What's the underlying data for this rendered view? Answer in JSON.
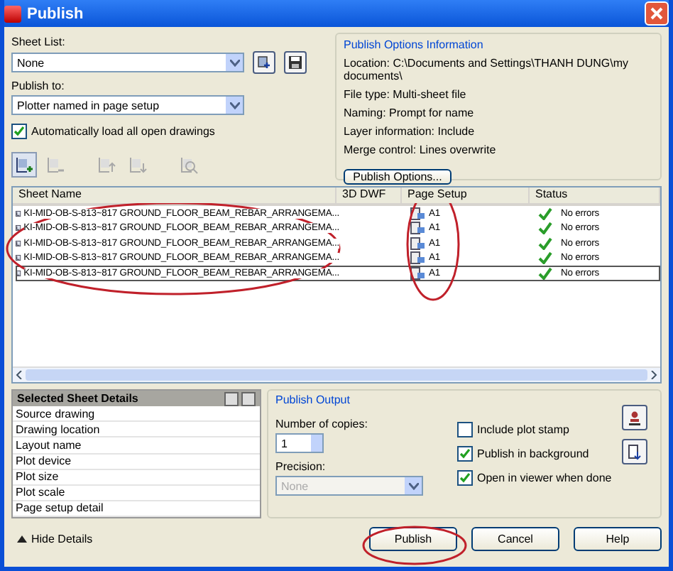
{
  "window": {
    "title": "Publish"
  },
  "sheet_list": {
    "label": "Sheet List:",
    "value": "None"
  },
  "publish_to": {
    "label": "Publish to:",
    "value": "Plotter named in page setup"
  },
  "auto_load": {
    "label": "Automatically load all open drawings",
    "checked": true
  },
  "toolbar": [
    {
      "kind": "add",
      "disabled": false
    },
    {
      "kind": "remove",
      "disabled": true
    },
    {
      "kind": "up",
      "disabled": true
    },
    {
      "kind": "down",
      "disabled": true
    },
    {
      "kind": "preview",
      "disabled": true
    }
  ],
  "options_info": {
    "title": "Publish Options Information",
    "lines": [
      "Location: C:\\Documents and Settings\\THANH DUNG\\my documents\\",
      "File type: Multi-sheet file",
      "Naming: Prompt for name",
      "Layer information: Include",
      "Merge control: Lines overwrite"
    ],
    "button": "Publish Options..."
  },
  "table": {
    "columns": [
      "Sheet Name",
      "3D DWF",
      "Page Setup",
      "Status"
    ],
    "rows": [
      {
        "sheet_name": "KI-MID-OB-S-813~817 GROUND_FLOOR_BEAM_REBAR_ARRANGEMA...",
        "page_setup": "A1",
        "status": "No errors",
        "selected": false
      },
      {
        "sheet_name": "KI-MID-OB-S-813~817 GROUND_FLOOR_BEAM_REBAR_ARRANGEMA...",
        "page_setup": "A1",
        "status": "No errors",
        "selected": false
      },
      {
        "sheet_name": "KI-MID-OB-S-813~817 GROUND_FLOOR_BEAM_REBAR_ARRANGEMA...",
        "page_setup": "A1",
        "status": "No errors",
        "selected": false
      },
      {
        "sheet_name": "KI-MID-OB-S-813~817 GROUND_FLOOR_BEAM_REBAR_ARRANGEMA...",
        "page_setup": "A1",
        "status": "No errors",
        "selected": false
      },
      {
        "sheet_name": "KI-MID-OB-S-813~817 GROUND_FLOOR_BEAM_REBAR_ARRANGEMA...",
        "page_setup": "A1",
        "status": "No errors",
        "selected": true
      }
    ]
  },
  "details": {
    "title": "Selected Sheet Details",
    "rows": [
      "Source drawing",
      "Drawing location",
      "Layout name",
      "Plot device",
      "Plot size",
      "Plot scale",
      "Page setup detail"
    ]
  },
  "output": {
    "title": "Publish Output",
    "copies_label": "Number of copies:",
    "copies": "1",
    "precision_label": "Precision:",
    "precision": {
      "value": "None",
      "disabled": true
    },
    "options": [
      {
        "label": "Include plot stamp",
        "checked": false
      },
      {
        "label": "Publish in background",
        "checked": true
      },
      {
        "label": "Open in viewer when done",
        "checked": true
      }
    ]
  },
  "hide_details": {
    "label": "Hide Details"
  },
  "buttons": [
    "Publish",
    "Cancel",
    "Help"
  ]
}
